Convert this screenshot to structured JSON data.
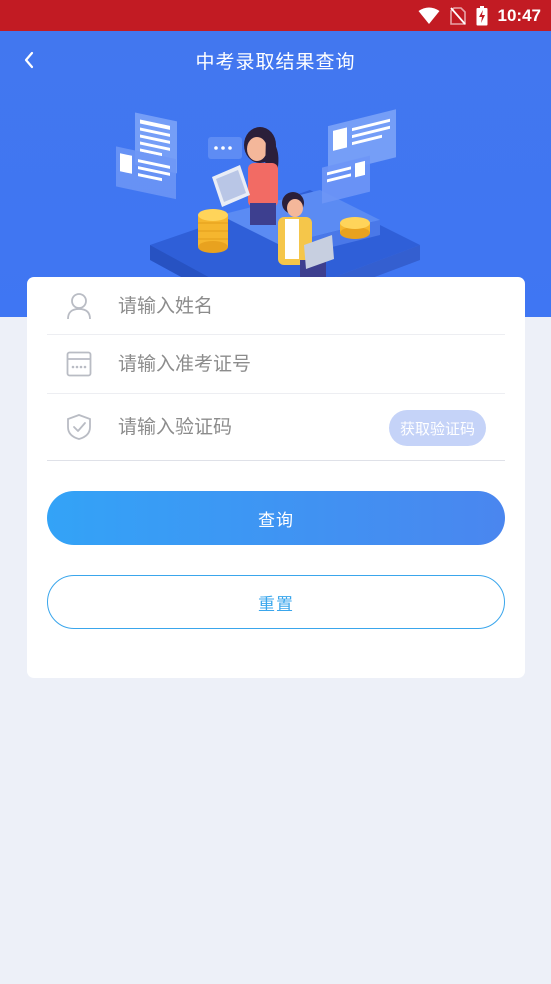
{
  "status_bar": {
    "time": "10:47",
    "icons": [
      "wifi-icon",
      "no-sim-icon",
      "battery-charging-icon"
    ]
  },
  "header": {
    "title": "中考录取结果查询",
    "back_icon": "chevron-left-icon",
    "illustration": "students-studying-illustration"
  },
  "form": {
    "name_field": {
      "placeholder": "请输入姓名",
      "value": "",
      "icon": "person-icon"
    },
    "ticket_field": {
      "placeholder": "请输入准考证号",
      "value": "",
      "icon": "id-card-icon"
    },
    "code_field": {
      "placeholder": "请输入验证码",
      "value": "",
      "icon": "shield-check-icon"
    },
    "get_code_label": "获取验证码",
    "query_label": "查询",
    "reset_label": "重置"
  },
  "colors": {
    "status_bar": "#c21b23",
    "header_blue": "#4277ef",
    "background": "#edf0f8",
    "query_gradient_start": "#33a3f7",
    "query_gradient_end": "#4a86ef",
    "reset_accent": "#3aa6ec",
    "code_button": "#c5d3f8"
  }
}
